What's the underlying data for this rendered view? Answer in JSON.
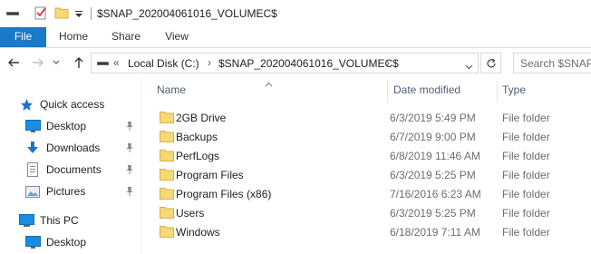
{
  "window": {
    "title": "$SNAP_202004061016_VOLUMEC$"
  },
  "ribbon": {
    "tabs": [
      "File",
      "Home",
      "Share",
      "View"
    ]
  },
  "address": {
    "overflow": "«",
    "crumbs": [
      "Local Disk (C:)",
      "$SNAP_202004061016_VOLUMEC$"
    ]
  },
  "search": {
    "placeholder": "Search $SNAP_..."
  },
  "navpane": {
    "items": [
      {
        "label": "Quick access",
        "icon": "star-icon",
        "pinned": false
      },
      {
        "label": "Desktop",
        "icon": "desktop-icon",
        "pinned": true
      },
      {
        "label": "Downloads",
        "icon": "download-icon",
        "pinned": true
      },
      {
        "label": "Documents",
        "icon": "documents-icon",
        "pinned": true
      },
      {
        "label": "Pictures",
        "icon": "pictures-icon",
        "pinned": true
      },
      {
        "label": "This PC",
        "icon": "computer-icon",
        "pinned": false
      },
      {
        "label": "Desktop",
        "icon": "desktop-icon",
        "pinned": false
      }
    ]
  },
  "filelist": {
    "columns": {
      "name": "Name",
      "date": "Date modified",
      "type": "Type"
    },
    "rows": [
      {
        "name": "2GB Drive",
        "date": "6/3/2019 5:49 PM",
        "type": "File folder"
      },
      {
        "name": "Backups",
        "date": "6/7/2019 9:00 PM",
        "type": "File folder"
      },
      {
        "name": "PerfLogs",
        "date": "6/8/2019 11:46 AM",
        "type": "File folder"
      },
      {
        "name": "Program Files",
        "date": "6/3/2019 5:25 PM",
        "type": "File folder"
      },
      {
        "name": "Program Files (x86)",
        "date": "7/16/2016 6:23 AM",
        "type": "File folder"
      },
      {
        "name": "Users",
        "date": "6/3/2019 5:25 PM",
        "type": "File folder"
      },
      {
        "name": "Windows",
        "date": "6/18/2019 7:11 AM",
        "type": "File folder"
      }
    ]
  },
  "colors": {
    "accent": "#1979ca",
    "folder": "#f8d775",
    "header_text": "#4c607a"
  }
}
